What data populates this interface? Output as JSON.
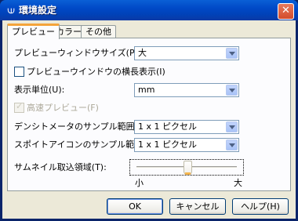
{
  "window": {
    "title": "環境設定",
    "close_label": "✕"
  },
  "tabs": [
    {
      "label": "プレビュー",
      "active": true
    },
    {
      "label": "カラー",
      "active": false
    },
    {
      "label": "その他",
      "active": false
    }
  ],
  "preview_size": {
    "label": "プレビューウィンドウサイズ(P):",
    "value": "大"
  },
  "landscape_checkbox": {
    "label": "プレビューウインドウの横長表示(I)",
    "checked": false
  },
  "display_unit": {
    "label": "表示単位(U):",
    "value": "mm"
  },
  "fast_preview": {
    "label": "高速プレビュー(F)",
    "checked": true,
    "enabled": false
  },
  "densitometer": {
    "label": "デンシトメータのサンプル範囲(D):",
    "value": "1 x 1 ピクセル"
  },
  "eyedropper": {
    "label": "スポイトアイコンのサンプル範囲(E):",
    "value": "1 x 1 ピクセル"
  },
  "thumbnail_area": {
    "label": "サムネイル取込領域(T):",
    "min_label": "小",
    "max_label": "大",
    "level_fraction": 0.47
  },
  "buttons": {
    "ok": "OK",
    "cancel": "キャンセル",
    "help": "ヘルプ(H)"
  }
}
